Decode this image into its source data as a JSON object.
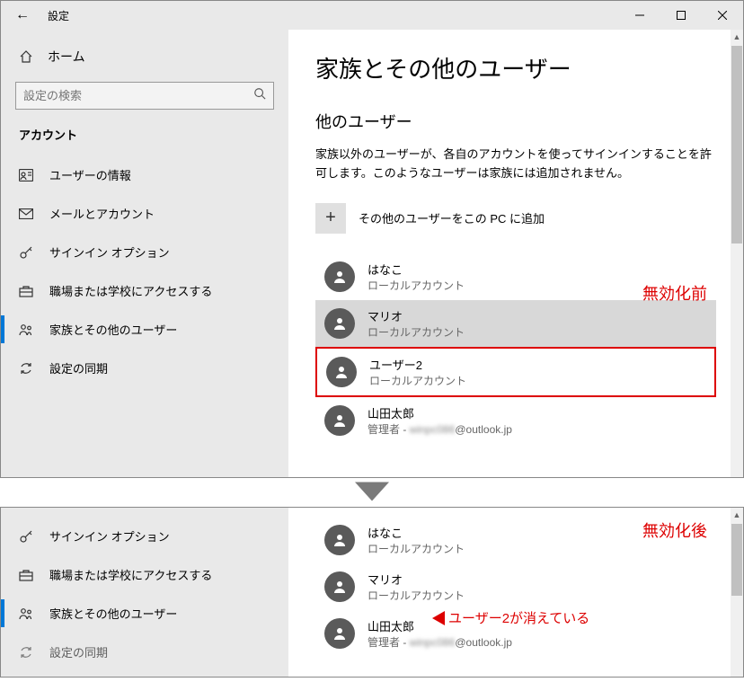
{
  "window": {
    "title": "設定",
    "home_label": "ホーム",
    "search_placeholder": "設定の検索",
    "section_label": "アカウント"
  },
  "sidebar": {
    "items": [
      {
        "label": "ユーザーの情報",
        "icon": "user-badge-icon"
      },
      {
        "label": "メールとアカウント",
        "icon": "mail-icon"
      },
      {
        "label": "サインイン オプション",
        "icon": "key-icon"
      },
      {
        "label": "職場または学校にアクセスする",
        "icon": "briefcase-icon"
      },
      {
        "label": "家族とその他のユーザー",
        "icon": "people-icon",
        "active": true
      },
      {
        "label": "設定の同期",
        "icon": "sync-icon"
      }
    ]
  },
  "main": {
    "page_title": "家族とその他のユーザー",
    "sub_head": "他のユーザー",
    "desc": "家族以外のユーザーが、各自のアカウントを使ってサインインすることを許可します。このようなユーザーは家族には追加されません。",
    "add_label": "その他のユーザーをこの PC に追加",
    "users_before": [
      {
        "name": "はなこ",
        "sub": "ローカルアカウント"
      },
      {
        "name": "マリオ",
        "sub": "ローカルアカウント",
        "selected": true
      },
      {
        "name": "ユーザー2",
        "sub": "ローカルアカウント",
        "boxed": true
      },
      {
        "name": "山田太郎",
        "sub_prefix": "管理者 - ",
        "sub_blur": "winpc086",
        "sub_suffix": "@outlook.jp"
      }
    ],
    "users_after": [
      {
        "name": "はなこ",
        "sub": "ローカルアカウント"
      },
      {
        "name": "マリオ",
        "sub": "ローカルアカウント"
      },
      {
        "name": "山田太郎",
        "sub_prefix": "管理者 - ",
        "sub_blur": "winpc086",
        "sub_suffix": "@outlook.jp"
      }
    ]
  },
  "sidebar2": {
    "items": [
      {
        "label": "サインイン オプション",
        "icon": "key-icon"
      },
      {
        "label": "職場または学校にアクセスする",
        "icon": "briefcase-icon"
      },
      {
        "label": "家族とその他のユーザー",
        "icon": "people-icon",
        "active": true
      },
      {
        "label": "設定の同期",
        "icon": "sync-icon",
        "partial": true
      }
    ]
  },
  "annotations": {
    "before_label": "無効化前",
    "after_label": "無効化後",
    "removed_note": "ユーザー2が消えている"
  }
}
